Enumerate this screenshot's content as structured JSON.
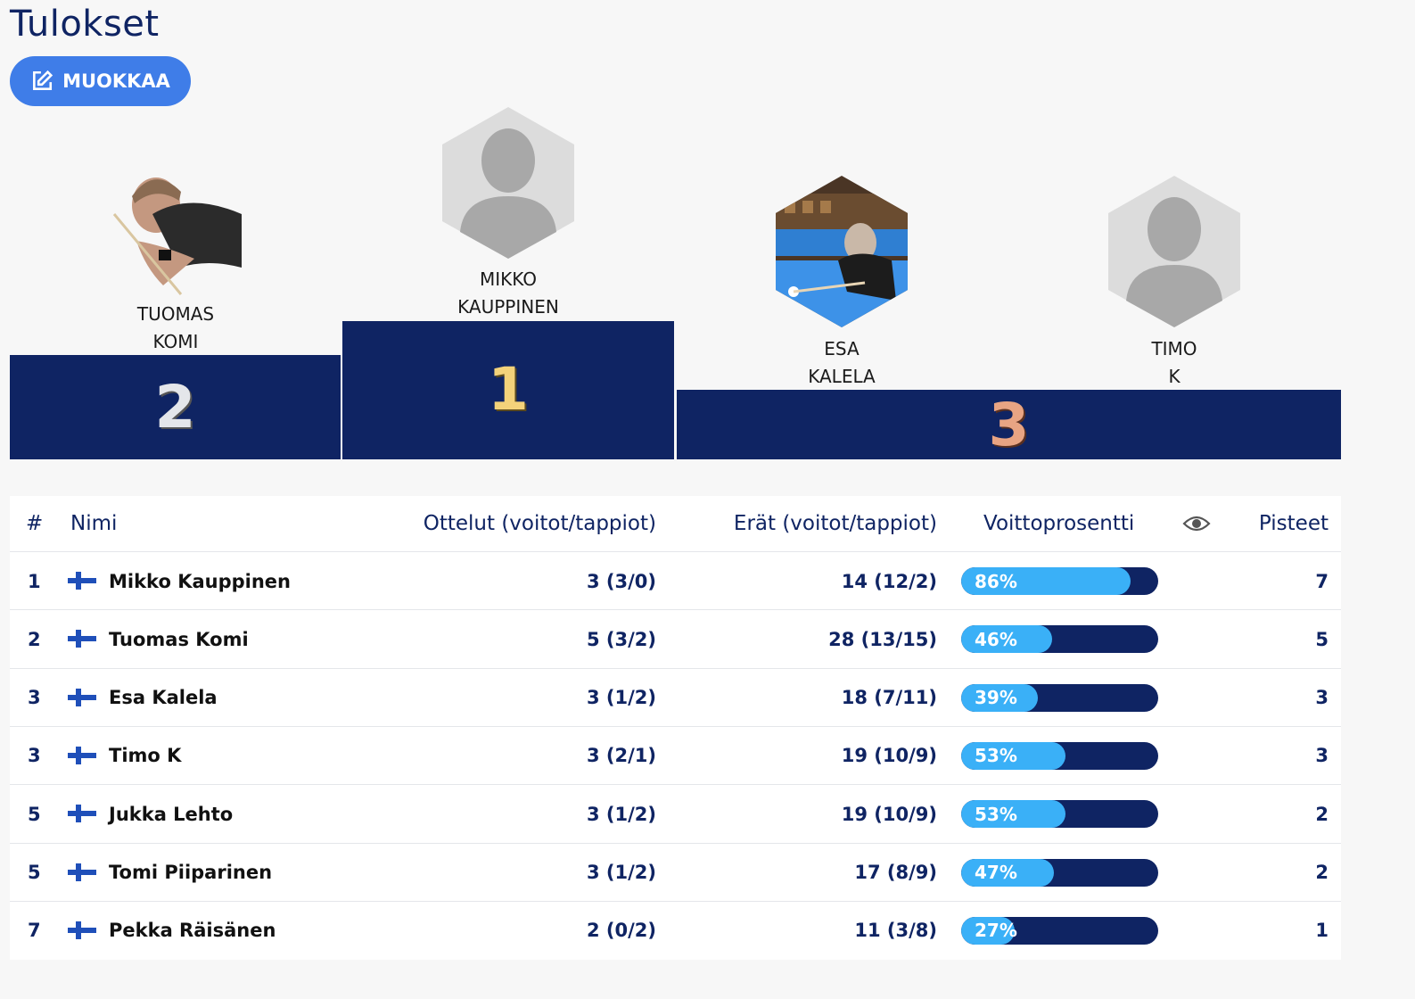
{
  "page": {
    "title": "Tulokset"
  },
  "edit_button": {
    "label": "MUOKKAA",
    "icon": "edit-icon"
  },
  "podium": [
    {
      "rank": "2",
      "first": "TUOMAS",
      "last": "KOMI",
      "avatar": "photo"
    },
    {
      "rank": "1",
      "first": "MIKKO",
      "last": "KAUPPINEN",
      "avatar": "placeholder"
    },
    {
      "rank": "3",
      "first": "ESA",
      "last": "KALELA",
      "avatar": "photo"
    },
    {
      "rank": "3",
      "first": "TIMO",
      "last": "K",
      "avatar": "placeholder"
    }
  ],
  "rank_colors": {
    "1": "#f3d27a",
    "2": "#e4e6ea",
    "3": "#e8a483"
  },
  "table": {
    "headers": {
      "rank": "#",
      "name": "Nimi",
      "matches": "Ottelut (voitot/tappiot)",
      "frames": "Erät (voitot/tappiot)",
      "win_pct": "Voittoprosentti",
      "visibility_icon": "eye-icon",
      "points": "Pisteet"
    },
    "rows": [
      {
        "rank": "1",
        "country": "finland-flag-icon",
        "name": "Mikko Kauppinen",
        "matches": "3 (3/0)",
        "frames": "14 (12/2)",
        "win_pct": 86,
        "win_pct_label": "86%",
        "points": "7"
      },
      {
        "rank": "2",
        "country": "finland-flag-icon",
        "name": "Tuomas Komi",
        "matches": "5 (3/2)",
        "frames": "28 (13/15)",
        "win_pct": 46,
        "win_pct_label": "46%",
        "points": "5"
      },
      {
        "rank": "3",
        "country": "finland-flag-icon",
        "name": "Esa Kalela",
        "matches": "3 (1/2)",
        "frames": "18 (7/11)",
        "win_pct": 39,
        "win_pct_label": "39%",
        "points": "3"
      },
      {
        "rank": "3",
        "country": "finland-flag-icon",
        "name": "Timo K",
        "matches": "3 (2/1)",
        "frames": "19 (10/9)",
        "win_pct": 53,
        "win_pct_label": "53%",
        "points": "3"
      },
      {
        "rank": "5",
        "country": "finland-flag-icon",
        "name": "Jukka Lehto",
        "matches": "3 (1/2)",
        "frames": "19 (10/9)",
        "win_pct": 53,
        "win_pct_label": "53%",
        "points": "2"
      },
      {
        "rank": "5",
        "country": "finland-flag-icon",
        "name": "Tomi Piiparinen",
        "matches": "3 (1/2)",
        "frames": "17 (8/9)",
        "win_pct": 47,
        "win_pct_label": "47%",
        "points": "2"
      },
      {
        "rank": "7",
        "country": "finland-flag-icon",
        "name": "Pekka Räisänen",
        "matches": "2 (0/2)",
        "frames": "11 (3/8)",
        "win_pct": 27,
        "win_pct_label": "27%",
        "points": "1"
      }
    ]
  }
}
